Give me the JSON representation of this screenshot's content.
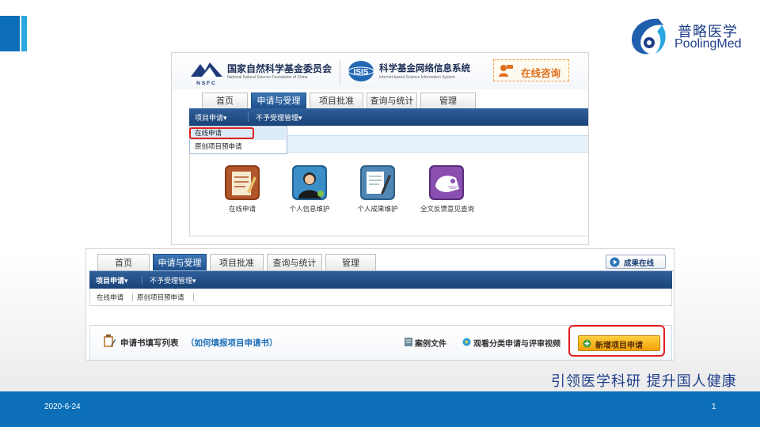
{
  "slide": {
    "slogan": "引领医学科研  提升国人健康",
    "date": "2020-6-24",
    "page_number": "1",
    "accent_color": "#0c6fb8"
  },
  "brand": {
    "name_cn": "普略医学",
    "name_en": "PoolingMed"
  },
  "screenshot_1": {
    "org_name_cn": "国家自然科学基金委员会",
    "org_name_en": "National Natural Science Foundation of China",
    "org_abbr": "NSFC",
    "system_name_cn": "科学基金网络信息系统",
    "system_name_en": "Internet-based Science Information System",
    "system_logo_text": "ISIS",
    "consult_label": "在线咨询",
    "tabs": [
      "首页",
      "申请与受理",
      "项目批准",
      "查询与统计",
      "管理"
    ],
    "active_tab": "申请与受理",
    "nav_items": [
      "项目申请▾",
      "不予受理管理▾"
    ],
    "dropdown_items": [
      "在线申请",
      "原创项目预申请"
    ],
    "apps": [
      {
        "label": "在线申请",
        "icon": "notepad-icon"
      },
      {
        "label": "个人信息维护",
        "icon": "person-icon"
      },
      {
        "label": "个人成果维护",
        "icon": "document-pen-icon"
      },
      {
        "label": "全文反馈意见查询",
        "icon": "feedback-icon"
      }
    ]
  },
  "screenshot_2": {
    "tabs": [
      "首页",
      "申请与受理",
      "项目批准",
      "查询与统计",
      "管理"
    ],
    "active_tab": "申请与受理",
    "results_label": "成果在线",
    "nav_items": [
      "项目申请▾",
      "不予受理管理▾"
    ],
    "sub_items": [
      "在线申请",
      "原创项目预申请"
    ],
    "form_title": "申请书填写列表",
    "form_help": "（如何填报项目申请书）",
    "case_label": "案例文件",
    "video_label": "观看分类申请与评审视频",
    "new_app_label": "新增项目申请"
  }
}
